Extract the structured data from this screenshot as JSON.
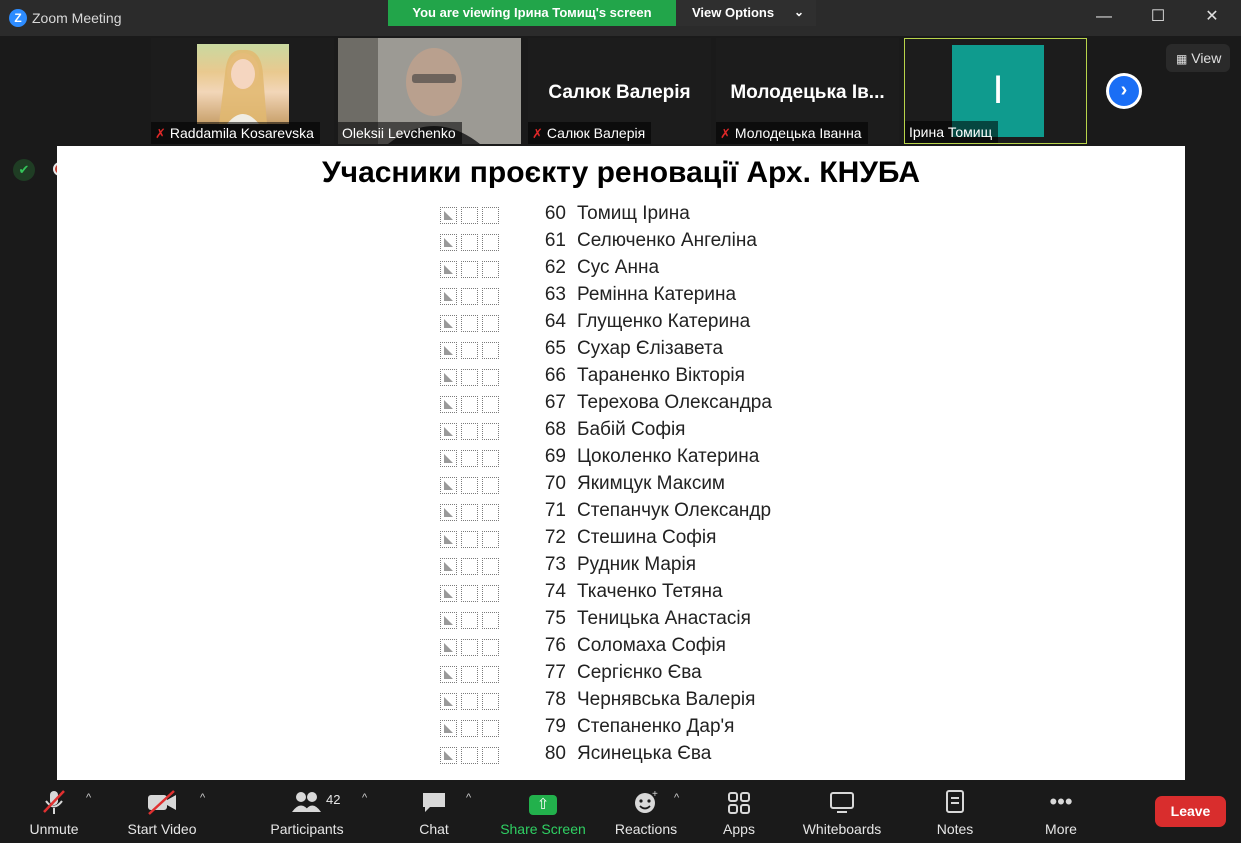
{
  "window": {
    "title": "Zoom Meeting",
    "logo_letter": "Z",
    "minimize": "—",
    "maximize": "☐",
    "close": "✕"
  },
  "banner": {
    "text": "You are viewing Ірина Томищ's screen",
    "view_options": "View Options",
    "color": "#22a54a"
  },
  "participants_strip": {
    "tiles": [
      {
        "name": "Raddamila Kosarevska",
        "muted": true,
        "kind": "video"
      },
      {
        "name": "Oleksii Levchenko",
        "muted": false,
        "kind": "video"
      },
      {
        "name": "Салюк Валерія",
        "muted": true,
        "kind": "name",
        "display": "Салюк Валерія"
      },
      {
        "name": "Молодецька Іванна",
        "muted": true,
        "kind": "name",
        "display": "Молодецька Ів..."
      },
      {
        "name": "Ірина Томищ",
        "muted": false,
        "kind": "avatar",
        "initial": "I",
        "avatar_color": "#0f9b8e",
        "active": true
      }
    ],
    "view_label": "View"
  },
  "shared_doc": {
    "title": "Учасники проєкту реновації Арх. КНУБА",
    "rows": [
      {
        "num": "60",
        "name": "Томищ Ірина"
      },
      {
        "num": "61",
        "name": "Селюченко Ангеліна"
      },
      {
        "num": "62",
        "name": "Сус Анна"
      },
      {
        "num": "63",
        "name": "Ремінна Катерина"
      },
      {
        "num": "64",
        "name": "Глущенко Катерина"
      },
      {
        "num": "65",
        "name": "Сухар Єлізавета"
      },
      {
        "num": "66",
        "name": "Тараненко Вікторія"
      },
      {
        "num": "67",
        "name": "Терехова Олександра"
      },
      {
        "num": "68",
        "name": "Бабій Софія"
      },
      {
        "num": "69",
        "name": "Цоколенко Катерина"
      },
      {
        "num": "70",
        "name": "Якимцук Максим"
      },
      {
        "num": "71",
        "name": "Степанчук Олександр"
      },
      {
        "num": "72",
        "name": "Стешина Софія"
      },
      {
        "num": "73",
        "name": "Рудник Марія"
      },
      {
        "num": "74",
        "name": "Ткаченко Тетяна"
      },
      {
        "num": "75",
        "name": "Теницька Анастасія"
      },
      {
        "num": "76",
        "name": "Соломаха Софія"
      },
      {
        "num": "77",
        "name": "Сергієнко Єва"
      },
      {
        "num": "78",
        "name": "Чернявська Валерія"
      },
      {
        "num": "79",
        "name": "Степаненко Дар'я"
      },
      {
        "num": "80",
        "name": "Ясинецька Єва"
      }
    ]
  },
  "toolbar": {
    "unmute": "Unmute",
    "start_video": "Start Video",
    "participants": "Participants",
    "participants_count": "42",
    "chat": "Chat",
    "share_screen": "Share Screen",
    "reactions": "Reactions",
    "apps": "Apps",
    "whiteboards": "Whiteboards",
    "notes": "Notes",
    "more": "More",
    "leave": "Leave",
    "leave_color": "#d92d2d",
    "share_color": "#22b14c"
  }
}
